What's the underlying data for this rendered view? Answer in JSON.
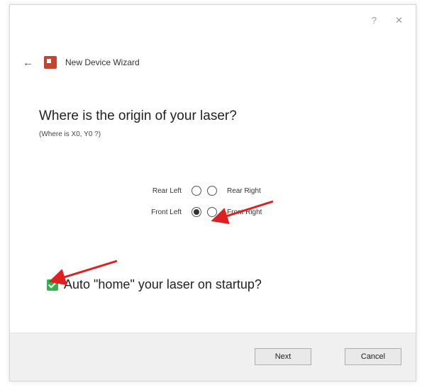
{
  "window": {
    "help_glyph": "?",
    "close_glyph": "✕"
  },
  "wizard": {
    "back_glyph": "←",
    "title": "New Device Wizard",
    "app_icon": "laser-app-icon"
  },
  "question": {
    "heading": "Where is the origin of your laser?",
    "subheading": "(Where is X0, Y0 ?)"
  },
  "origin_options": [
    {
      "label": "Rear Left",
      "checked": false
    },
    {
      "label": "Rear Right",
      "checked": false
    },
    {
      "label": "Front Left",
      "checked": true
    },
    {
      "label": "Front Right",
      "checked": false
    }
  ],
  "autohome": {
    "label": "Auto \"home\" your laser on startup?",
    "checked": true
  },
  "buttons": {
    "next": "Next",
    "cancel": "Cancel"
  },
  "colors": {
    "annotation_arrow": "#e02020",
    "checkbox_green": "#35b34a",
    "app_icon_red": "#c8432e"
  }
}
